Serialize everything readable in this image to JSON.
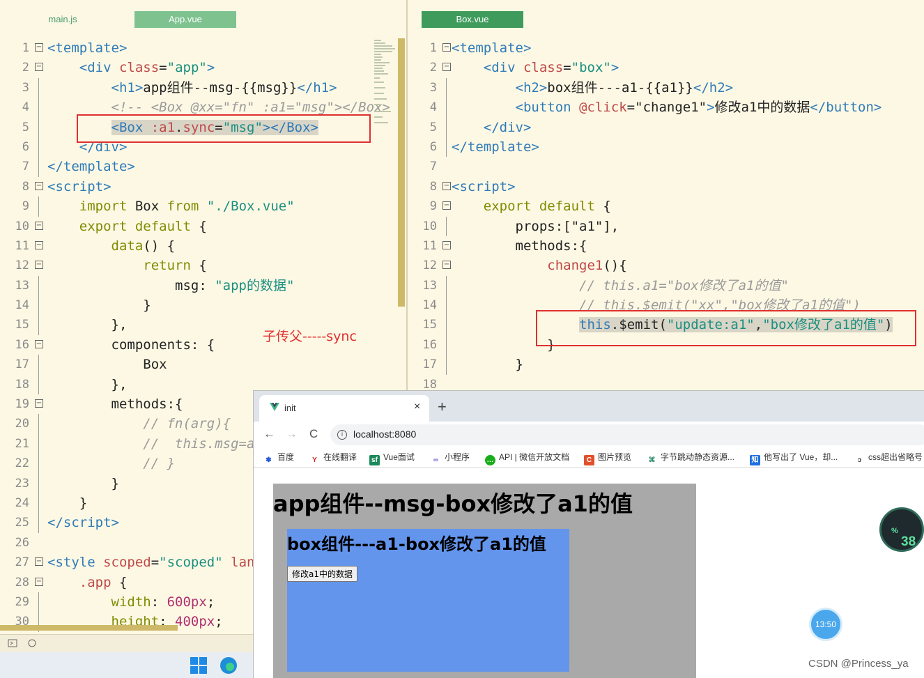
{
  "left_editor": {
    "tabs": [
      "main.js",
      "App.vue"
    ],
    "line_numbers": [
      "1",
      "2",
      "3",
      "4",
      "5",
      "6",
      "7",
      "8",
      "9",
      "10",
      "11",
      "12",
      "13",
      "14",
      "15",
      "16",
      "17",
      "18",
      "19",
      "20",
      "21",
      "22",
      "23",
      "24",
      "25",
      "26",
      "27",
      "28",
      "29",
      "30"
    ]
  },
  "right_editor": {
    "tabs": [
      "Box.vue"
    ],
    "line_numbers": [
      "1",
      "2",
      "3",
      "4",
      "5",
      "6",
      "7",
      "8",
      "9",
      "10",
      "11",
      "12",
      "13",
      "14",
      "15",
      "16",
      "17",
      "18"
    ]
  },
  "annotation": "子传父-----sync",
  "browser": {
    "tab_title": "init",
    "tab_close": "×",
    "new_tab": "+",
    "url": "localhost:8080",
    "nav": {
      "back": "←",
      "forward": "→",
      "reload": "C"
    },
    "bookmarks": [
      "百度",
      "在线翻译",
      "Vue面试",
      "小程序",
      "API | 微信开放文档",
      "图片预览",
      "字节跳动静态资源...",
      "他写出了 Vue，却...",
      "css超出省略号"
    ],
    "page": {
      "h1": "app组件--msg-box修改了a1的值",
      "h2": "box组件---a1-box修改了a1的值",
      "button": "修改a1中的数据"
    }
  },
  "overlay": {
    "gauge": "38",
    "gauge_unit": "%",
    "clock": "13:50"
  },
  "watermark": "CSDN @Princess_ya"
}
